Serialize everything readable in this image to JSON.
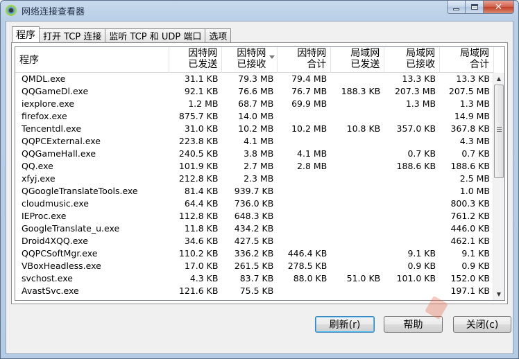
{
  "window": {
    "title": "网络连接查看器"
  },
  "tabs": [
    {
      "label": "程序"
    },
    {
      "label": "打开 TCP 连接"
    },
    {
      "label": "监听 TCP 和 UDP 端口"
    },
    {
      "label": "选项"
    }
  ],
  "columns": [
    {
      "line1": "程序",
      "line2": ""
    },
    {
      "line1": "因特网",
      "line2": "已发送"
    },
    {
      "line1": "因特网",
      "line2": "已接收"
    },
    {
      "line1": "因特网",
      "line2": "合计"
    },
    {
      "line1": "局域网",
      "line2": "已发送"
    },
    {
      "line1": "局域网",
      "line2": "已接收"
    },
    {
      "line1": "局域网",
      "line2": "合计"
    }
  ],
  "rows": [
    [
      "QMDL.exe",
      "31.1 KB",
      "79.3 MB",
      "79.4 MB",
      "",
      "13.3 KB",
      "13.3 KB"
    ],
    [
      "QQGameDl.exe",
      "92.1 KB",
      "76.6 MB",
      "76.7 MB",
      "188.3 KB",
      "207.3 MB",
      "207.5 MB"
    ],
    [
      "iexplore.exe",
      "1.2 MB",
      "68.7 MB",
      "69.9 MB",
      "",
      "1.3 MB",
      "1.3 MB"
    ],
    [
      "firefox.exe",
      "875.7 KB",
      "14.0 MB",
      "",
      "",
      "",
      "14.9 MB"
    ],
    [
      "Tencentdl.exe",
      "31.0 KB",
      "10.2 MB",
      "10.2 MB",
      "10.8 KB",
      "357.0 KB",
      "367.8 KB"
    ],
    [
      "QQPCExternal.exe",
      "223.8 KB",
      "4.1 MB",
      "",
      "",
      "",
      "4.3 MB"
    ],
    [
      "QQGameHall.exe",
      "240.5 KB",
      "3.8 MB",
      "4.1 MB",
      "",
      "0.7 KB",
      "0.7 KB"
    ],
    [
      "QQ.exe",
      "101.9 KB",
      "2.7 MB",
      "2.8 MB",
      "",
      "188.6 KB",
      "188.6 KB"
    ],
    [
      "xfyj.exe",
      "212.8 KB",
      "2.3 MB",
      "",
      "",
      "",
      "2.5 MB"
    ],
    [
      "QGoogleTranslateTools.exe",
      "81.4 KB",
      "939.7 KB",
      "",
      "",
      "",
      "1.0 MB"
    ],
    [
      "cloudmusic.exe",
      "64.4 KB",
      "736.0 KB",
      "",
      "",
      "",
      "800.3 KB"
    ],
    [
      "IEProc.exe",
      "112.8 KB",
      "648.3 KB",
      "",
      "",
      "",
      "761.2 KB"
    ],
    [
      "GoogleTranslate_u.exe",
      "11.8 KB",
      "434.2 KB",
      "",
      "",
      "",
      "446.0 KB"
    ],
    [
      "Droid4XQQ.exe",
      "34.6 KB",
      "427.5 KB",
      "",
      "",
      "",
      "462.1 KB"
    ],
    [
      "QQPCSoftMgr.exe",
      "110.2 KB",
      "336.2 KB",
      "446.4 KB",
      "",
      "9.1 KB",
      "9.1 KB"
    ],
    [
      "VBoxHeadless.exe",
      "17.0 KB",
      "261.5 KB",
      "278.5 KB",
      "",
      "0.9 KB",
      "0.9 KB"
    ],
    [
      "svchost.exe",
      "4.3 KB",
      "83.7 KB",
      "88.0 KB",
      "51.0 KB",
      "101.0 KB",
      "152.0 KB"
    ],
    [
      "AvastSvc.exe",
      "121.6 KB",
      "75.5 KB",
      "",
      "",
      "",
      "197.1 KB"
    ]
  ],
  "buttons": {
    "refresh": "刷新(r)",
    "help": "帮助",
    "close": "关闭(c)"
  }
}
